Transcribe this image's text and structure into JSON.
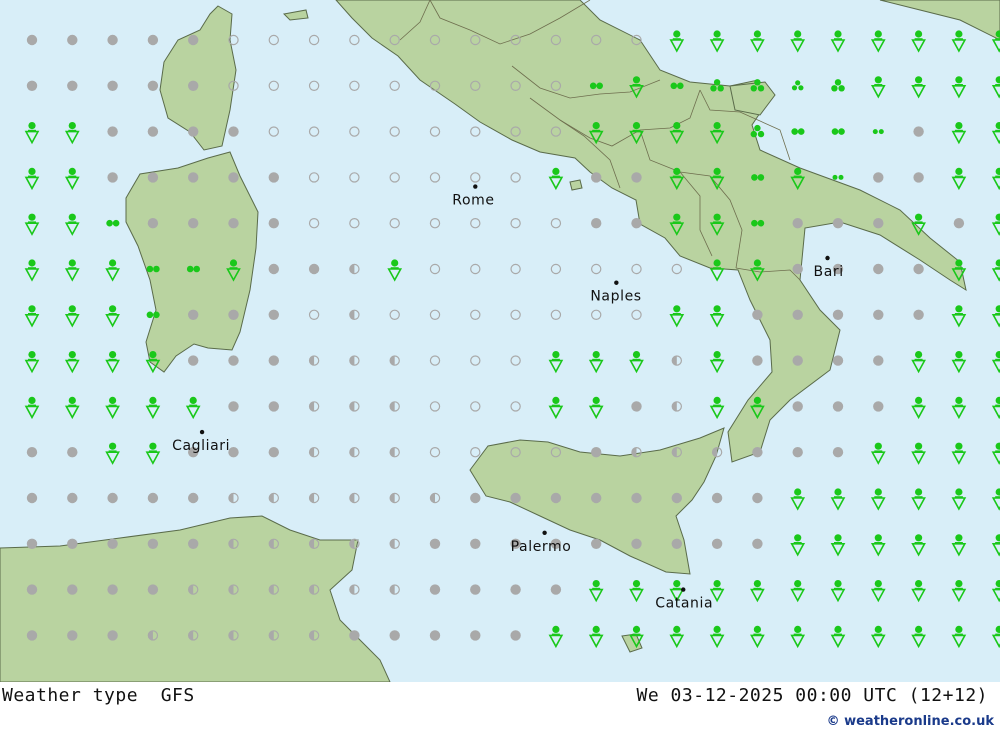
{
  "footer": {
    "title": "Weather type  GFS",
    "datetime": "We 03-12-2025 00:00 UTC (12+12)",
    "credit": "© weatheronline.co.uk"
  },
  "cities": [
    {
      "name": "Rome",
      "lon": 12.5,
      "lat": 41.9
    },
    {
      "name": "Naples",
      "lon": 14.25,
      "lat": 40.85
    },
    {
      "name": "Bari",
      "lon": 16.87,
      "lat": 41.12
    },
    {
      "name": "Cagliari",
      "lon": 9.11,
      "lat": 39.22
    },
    {
      "name": "Palermo",
      "lon": 13.36,
      "lat": 38.12
    },
    {
      "name": "Catania",
      "lon": 15.08,
      "lat": 37.5
    }
  ],
  "legend_colors": {
    "sea": "#d8eef8",
    "land": "#b9d3a0",
    "overcast": "#a9a9a9",
    "rain": "#1ac81a"
  },
  "symbol_grid": [
    "OOOOOoooooooooooCCCCCCCCC",
    "OOOOOoooooooooRCRFFGFCCCC",
    "CCOOOOooooooooCCCCFRRVOCC",
    "CCOOOOOooooooCOOCCRCVOOCC",
    "CCROOOOoooooooOOCCROOOCOC",
    "CCCRRCOOhCoooooooCCOOOOCC",
    "CCCROOOohoooooooCCOOOOOCC",
    "CCCCOOOhhhoooCCChCOOOOCCC",
    "CCCCCOOhhhoooCCOhCCOOOCCC",
    "OOCCOOOhhhooooOhhhOOOCCCC",
    "OOOOOhhhhhhOOOOOOOOCCCCCC",
    "OOOOOhhhhhOOOOOOOOOCCCCCC",
    "OOOOhhhhhhOOOOCCCCCCCCCCC",
    "OOOhhhhhOOOOOCCCCCCCCCCCC"
  ]
}
